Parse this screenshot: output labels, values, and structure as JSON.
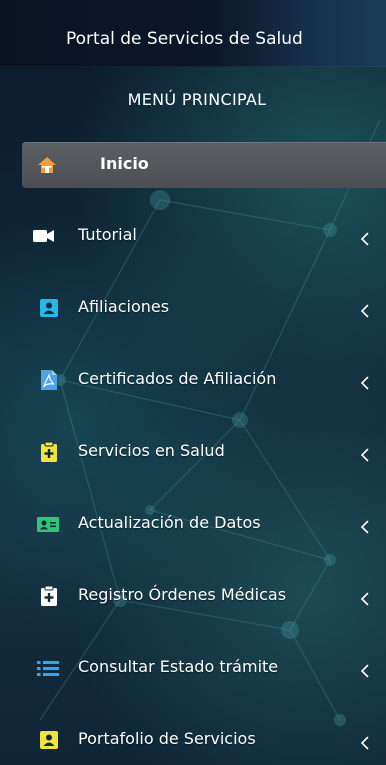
{
  "brand": {
    "title": "Portal de Servicios de Salud"
  },
  "menu": {
    "header": "MENÚ PRINCIPAL",
    "home": {
      "label": "Inicio",
      "icon": "home-icon"
    },
    "items": [
      {
        "label": "Tutorial",
        "icon": "video-camera-icon",
        "icon_color": "#ffffff"
      },
      {
        "label": "Afiliaciones",
        "icon": "id-badge-icon",
        "icon_color": "#29b6e8"
      },
      {
        "label": "Certificados de Afiliación",
        "icon": "pdf-file-icon",
        "icon_color": "#4da3e6"
      },
      {
        "label": "Servicios en Salud",
        "icon": "medical-clipboard-icon",
        "icon_color": "#f2e43c"
      },
      {
        "label": "Actualización de Datos",
        "icon": "id-card-icon",
        "icon_color": "#2ec77a"
      },
      {
        "label": "Registro Órdenes Médicas",
        "icon": "medical-clipboard-icon",
        "icon_color": "#ffffff"
      },
      {
        "label": "Consultar Estado trámite",
        "icon": "list-icon",
        "icon_color": "#3aa0f0"
      },
      {
        "label": "Portafolio de Servicios",
        "icon": "id-badge-icon",
        "icon_color": "#f2e43c"
      }
    ]
  },
  "colors": {
    "active_bg": "#55585c",
    "home_icon": "#f29b3f",
    "background": "#0f2738"
  }
}
